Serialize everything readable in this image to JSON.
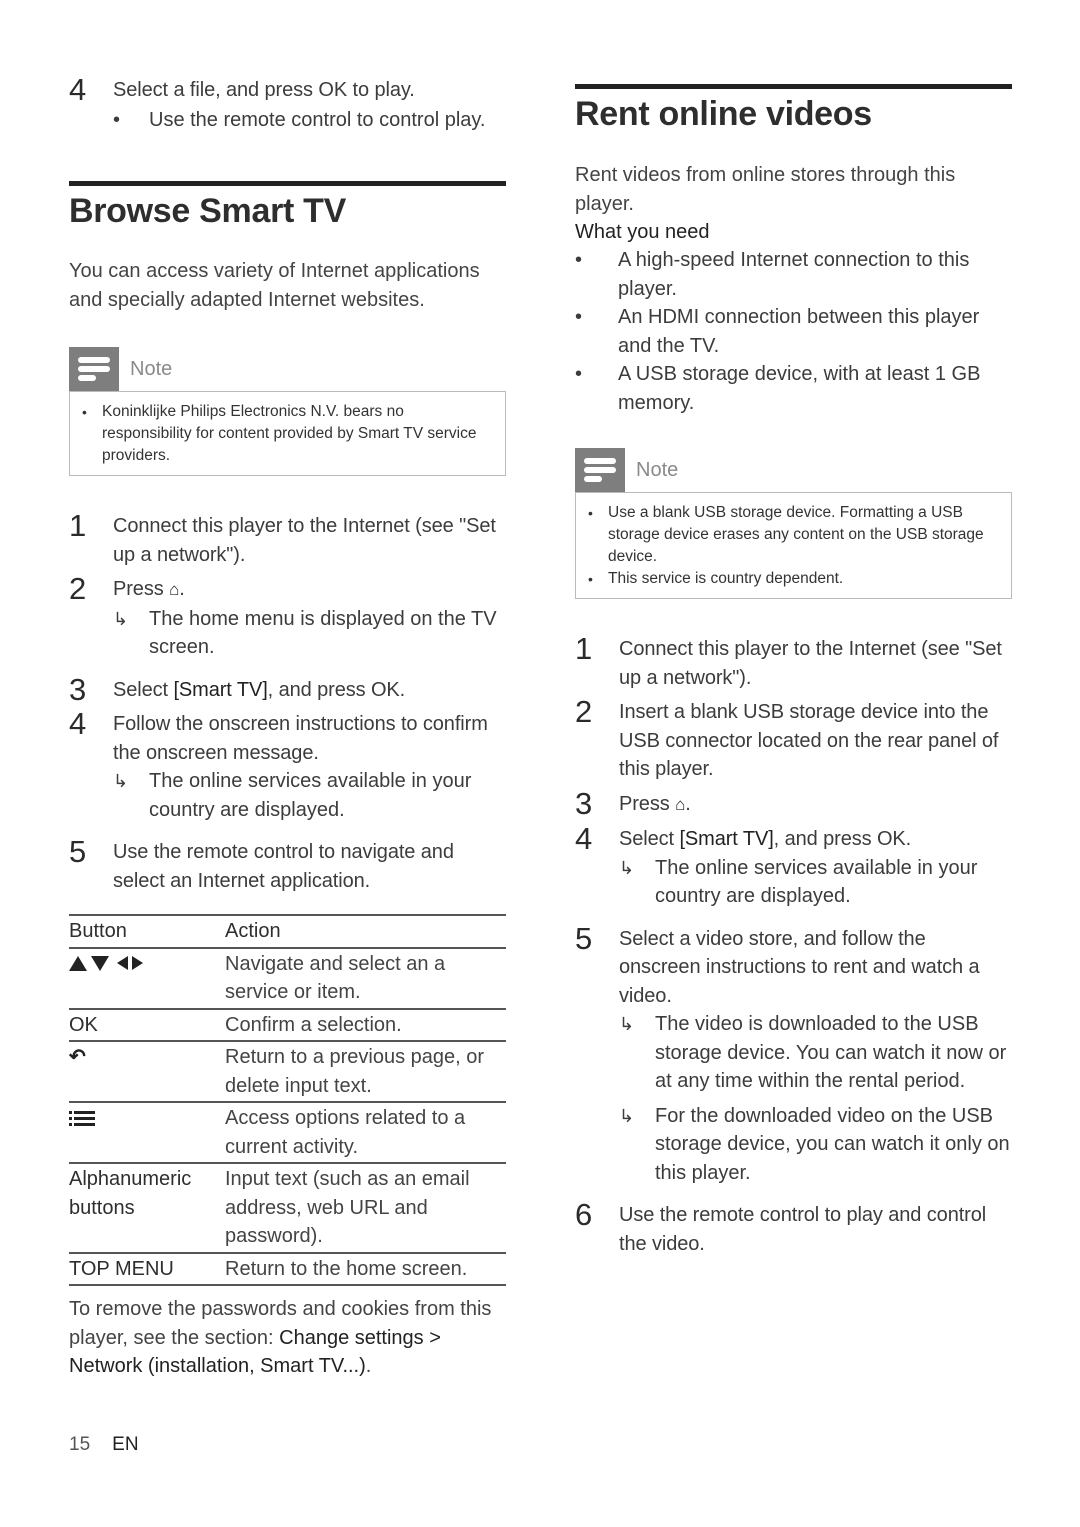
{
  "left": {
    "prev_step": {
      "number": "4",
      "text": "Select a file, and press OK to play.",
      "bullet": "Use the remote control to control play."
    },
    "section_title": "Browse Smart TV",
    "intro": "You can access variety of Internet applications and specially adapted Internet websites.",
    "note": {
      "label": "Note",
      "icon": "note-icon",
      "items": [
        "Koninklijke Philips Electronics N.V. bears no responsibility for content provided by Smart TV service providers."
      ]
    },
    "steps": [
      {
        "number": "1",
        "text": "Connect this player to the Internet (see \"Set up a network\")."
      },
      {
        "number": "2",
        "text_before": "Press ",
        "icon": "home-icon",
        "text_after": ".",
        "result": "The home menu is displayed on the TV screen."
      },
      {
        "number": "3",
        "text_before": "Select ",
        "bold": "[Smart TV]",
        "text_after": ", and press OK."
      },
      {
        "number": "4",
        "text": "Follow the onscreen instructions to confirm the onscreen message.",
        "result": "The online services available in your country are displayed."
      },
      {
        "number": "5",
        "text": "Use the remote control to navigate and select an Internet application."
      }
    ],
    "table": {
      "headers": [
        "Button",
        "Action"
      ],
      "rows": [
        {
          "button_icon": "arrow-keys-icon",
          "button": "▲▼◀▶",
          "action": "Navigate and select an a service or item."
        },
        {
          "button": "OK",
          "action": "Confirm a selection."
        },
        {
          "button_icon": "back-icon",
          "button": "⮌",
          "action": "Return to a previous page, or delete input text."
        },
        {
          "button_icon": "options-icon",
          "button": "≔",
          "action": "Access options related to a current activity."
        },
        {
          "button": "Alphanumeric buttons",
          "action": "Input text (such as an email address, web URL and password)."
        },
        {
          "button": "TOP MENU",
          "action": "Return to the home screen."
        }
      ]
    },
    "footer_note": {
      "text": "To remove the passwords and cookies from this player, see the section: ",
      "link": "Change settings > Network (installation, Smart TV...)",
      "end": "."
    }
  },
  "right": {
    "section_title": "Rent online videos",
    "intro": "Rent videos from online stores through this player.",
    "need_heading": "What you need",
    "needs": [
      "A high-speed Internet connection to this player.",
      "An HDMI connection between this player and the TV.",
      "A USB storage device, with at least 1 GB memory."
    ],
    "note": {
      "label": "Note",
      "icon": "note-icon",
      "items": [
        "Use a blank USB storage device. Formatting a USB storage device erases any content on the USB storage device.",
        "This service is country dependent."
      ]
    },
    "steps": [
      {
        "number": "1",
        "text": "Connect this player to the Internet (see \"Set up a network\")."
      },
      {
        "number": "2",
        "text": "Insert a blank USB storage device into the USB connector located on the rear panel of this player."
      },
      {
        "number": "3",
        "text_before": "Press ",
        "icon": "home-icon",
        "text_after": "."
      },
      {
        "number": "4",
        "text_before": "Select ",
        "bold": "[Smart TV]",
        "text_after": ", and press OK.",
        "result": "The online services available in your country are displayed."
      },
      {
        "number": "5",
        "text": "Select a video store, and follow the onscreen instructions to rent and watch a video.",
        "results": [
          "The video is downloaded to the USB storage device. You can watch it now or at any time within the rental period.",
          "For the downloaded video on the USB storage device, you can watch it only on this player."
        ]
      },
      {
        "number": "6",
        "text": "Use the remote control to play and control the video."
      }
    ]
  },
  "footer": {
    "page_number": "15",
    "language": "EN"
  },
  "glyphs": {
    "bullet": "•",
    "result_arrow": "↳",
    "home": "⌂",
    "back": "⮌"
  }
}
